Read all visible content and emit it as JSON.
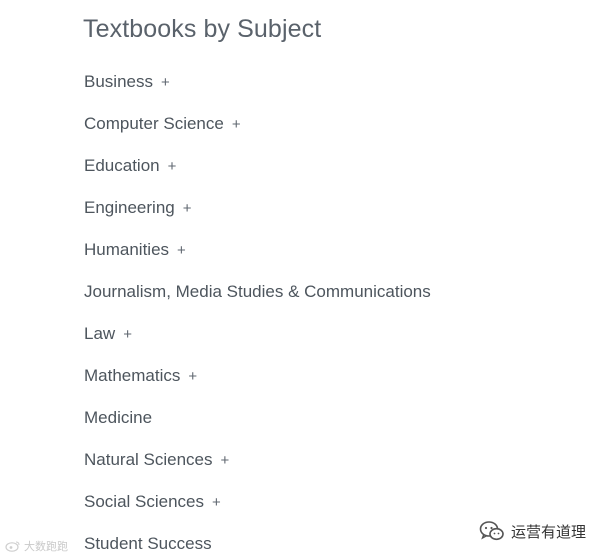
{
  "heading": "Textbooks by Subject",
  "expand_symbol": "+",
  "subjects": [
    {
      "label": "Business",
      "expandable": true
    },
    {
      "label": "Computer Science",
      "expandable": true
    },
    {
      "label": "Education",
      "expandable": true
    },
    {
      "label": "Engineering",
      "expandable": true
    },
    {
      "label": "Humanities",
      "expandable": true
    },
    {
      "label": "Journalism, Media Studies & Communications",
      "expandable": false
    },
    {
      "label": "Law",
      "expandable": true
    },
    {
      "label": "Mathematics",
      "expandable": true
    },
    {
      "label": "Medicine",
      "expandable": false
    },
    {
      "label": "Natural Sciences",
      "expandable": true
    },
    {
      "label": "Social Sciences",
      "expandable": true
    },
    {
      "label": "Student Success",
      "expandable": false
    }
  ],
  "watermarks": {
    "left_text": "大数跑跑",
    "right_text": "运营有道理",
    "right_icon": "wechat-icon",
    "left_icon": "weibo-icon"
  },
  "colors": {
    "heading": "#5a626b",
    "item_text": "#4d555d",
    "background": "#ffffff"
  }
}
